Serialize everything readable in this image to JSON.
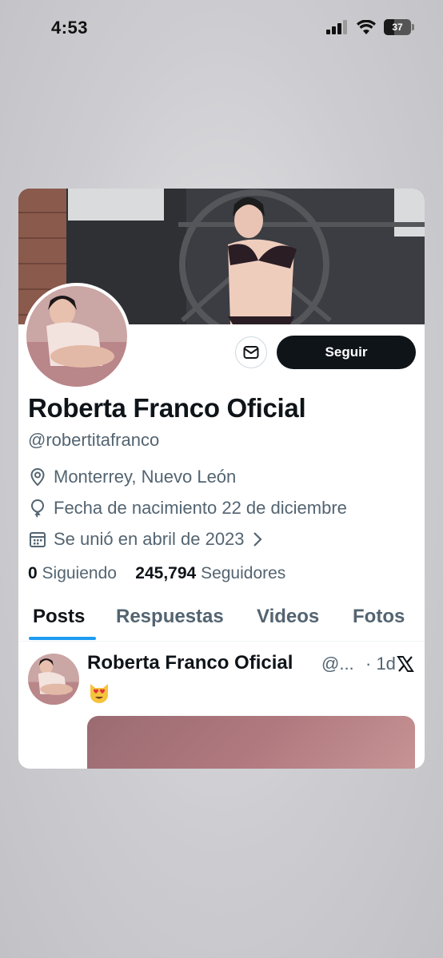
{
  "status_bar": {
    "time": "4:53",
    "battery": "37"
  },
  "profile": {
    "name": "Roberta Franco Oficial",
    "handle": "@robertitafranco",
    "follow_label": "Seguir",
    "location": "Monterrey, Nuevo León",
    "birthday": "Fecha de nacimiento 22 de diciembre",
    "joined": "Se unió en abril de 2023",
    "following_count": "0",
    "following_label": "Siguiendo",
    "followers_count": "245,794",
    "followers_label": "Seguidores"
  },
  "tabs": [
    {
      "label": "Posts",
      "active": true
    },
    {
      "label": "Respuestas",
      "active": false
    },
    {
      "label": "Videos",
      "active": false
    },
    {
      "label": "Fotos",
      "active": false
    }
  ],
  "post": {
    "author": "Roberta Franco Oficial",
    "handle": "@...",
    "time": "· 1d",
    "emoji": "heart-eyes-cat-emoji"
  },
  "icons": [
    "signal-icon",
    "wifi-icon",
    "battery-icon",
    "message-icon",
    "location-icon",
    "balloon-icon",
    "calendar-icon",
    "chevron-right-icon",
    "x-logo-icon"
  ],
  "colors": {
    "accent": "#1d9bf0",
    "text": "#0f1419",
    "secondary_text": "#536471",
    "button": "#0f1419"
  }
}
